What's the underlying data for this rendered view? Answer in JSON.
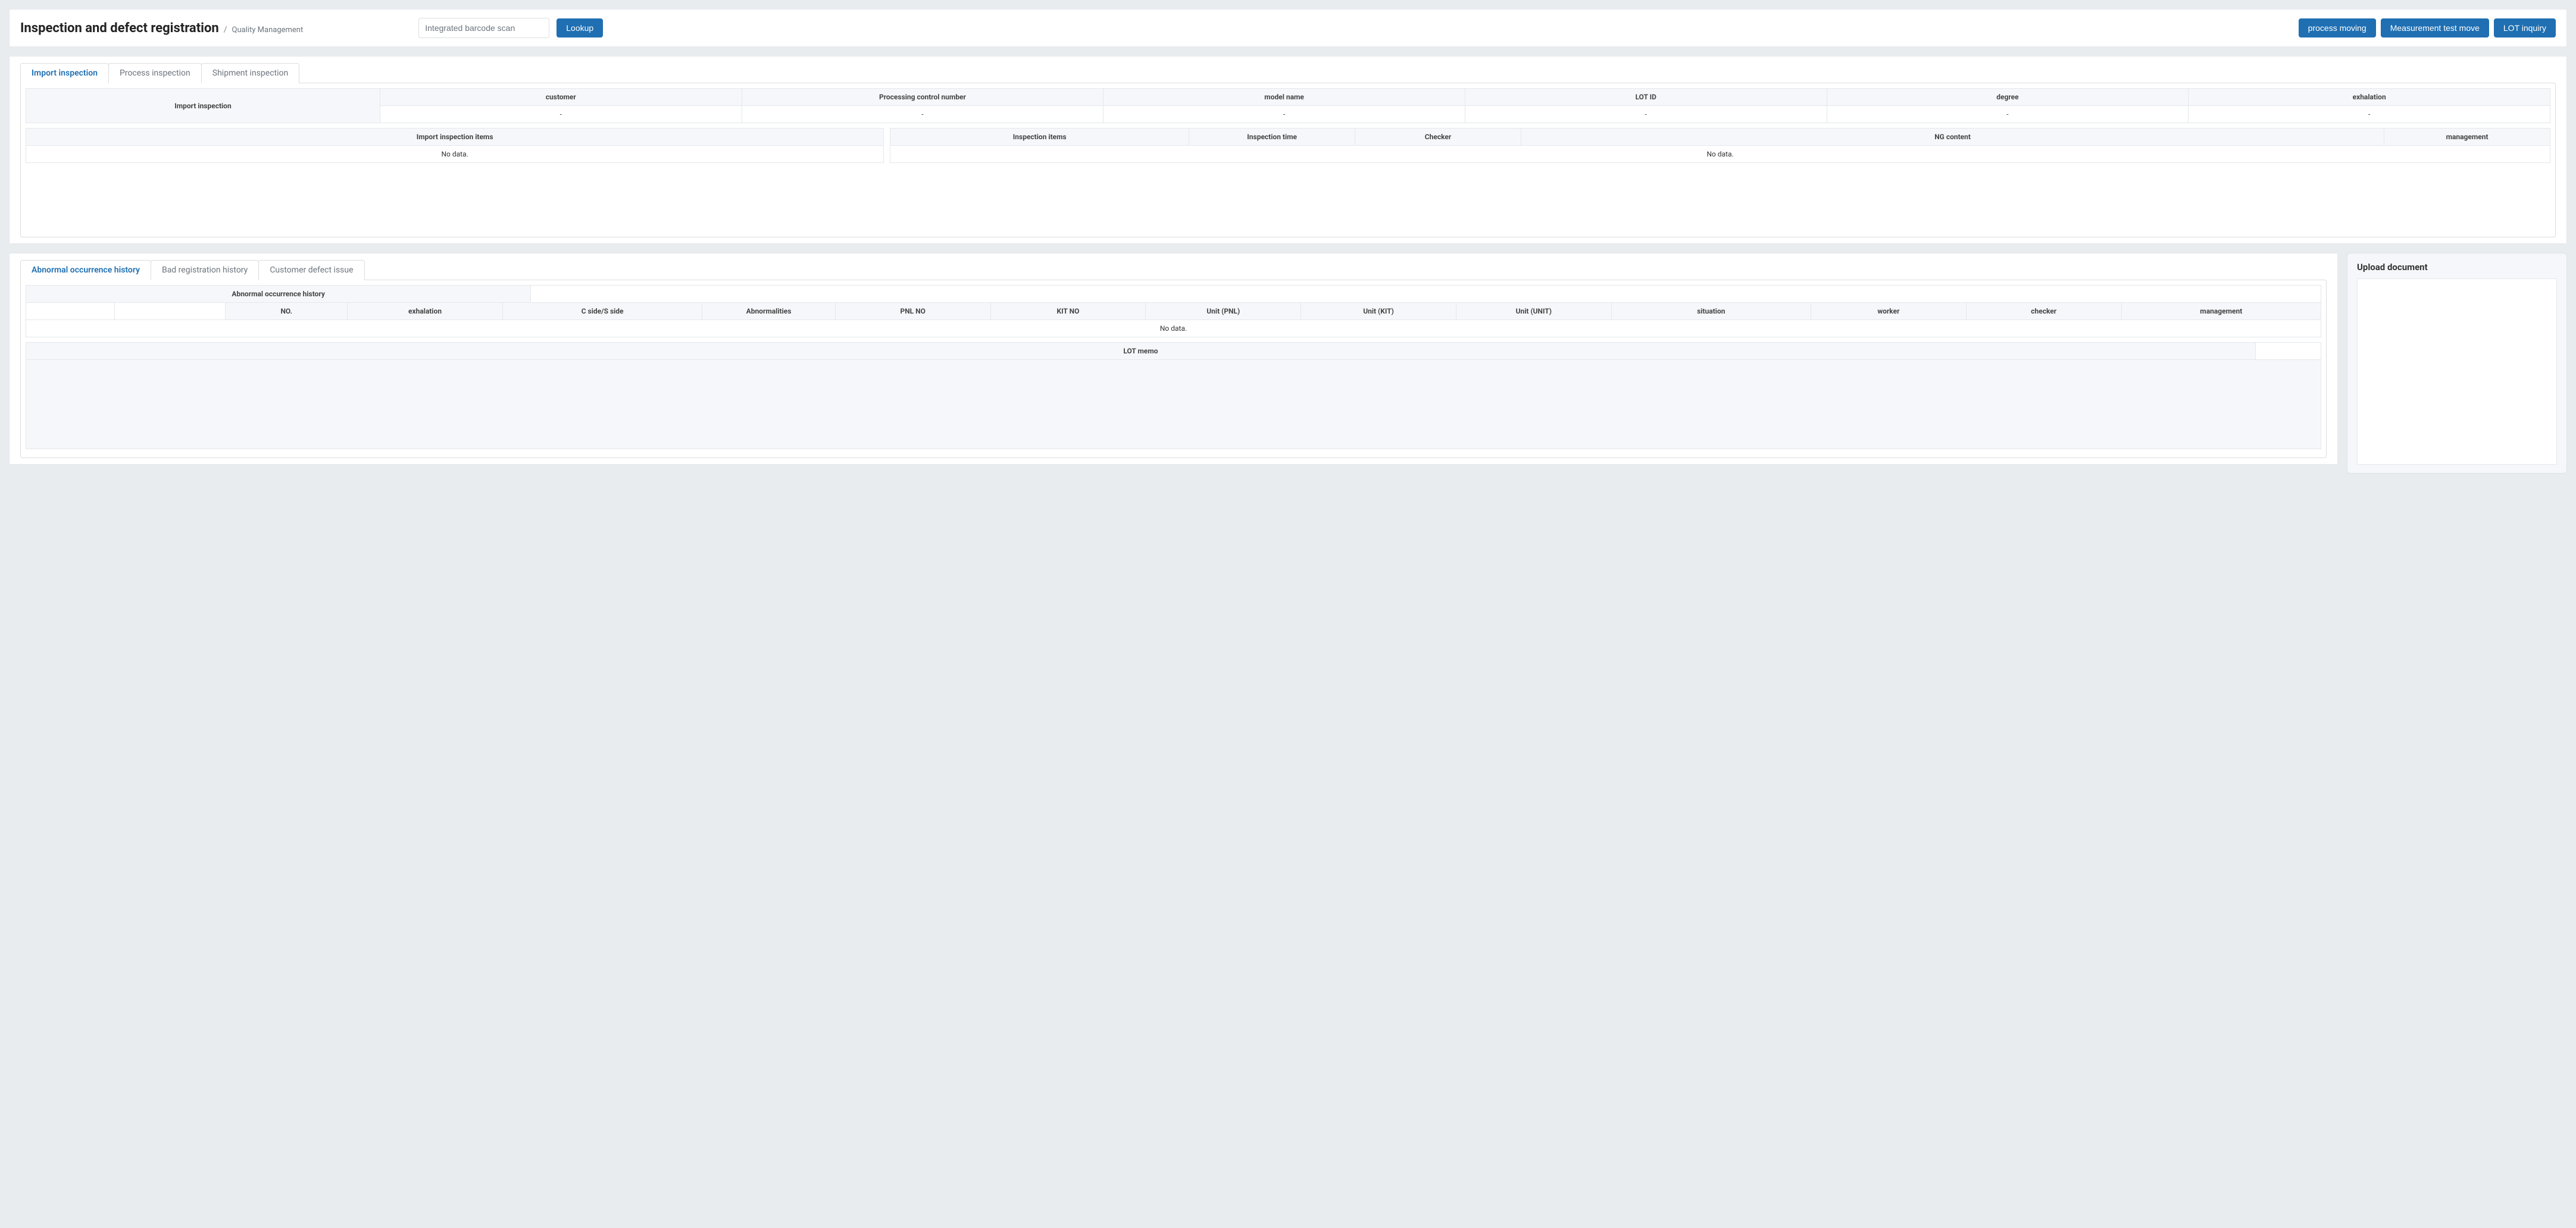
{
  "header": {
    "title": "Inspection and defect registration",
    "breadcrumb_sep": "/",
    "breadcrumb_sub": "Quality Management",
    "barcode_placeholder": "Integrated barcode scan",
    "lookup_label": "Lookup",
    "buttons": {
      "process_moving": "process moving",
      "measurement_test_move": "Measurement test move",
      "lot_inquiry": "LOT inquiry"
    }
  },
  "inspect_tabs": {
    "items": [
      {
        "label": "Import inspection"
      },
      {
        "label": "Process inspection"
      },
      {
        "label": "Shipment inspection"
      }
    ],
    "info_row_header": "Import inspection",
    "info_cols": [
      "customer",
      "Processing control number",
      "model name",
      "LOT ID",
      "degree",
      "exhalation"
    ],
    "info_vals": [
      "-",
      "-",
      "-",
      "-",
      "-",
      "-"
    ],
    "left_table": {
      "header": "Import inspection items",
      "no_data": "No data."
    },
    "right_table": {
      "headers": [
        "Inspection items",
        "Inspection time",
        "Checker",
        "NG content",
        "management"
      ],
      "no_data": "No data."
    }
  },
  "history_tabs": {
    "items": [
      {
        "label": "Abnormal occurrence history"
      },
      {
        "label": "Bad registration history"
      },
      {
        "label": "Customer defect issue"
      }
    ],
    "row_header": "Abnormal occurrence history",
    "cols": [
      "NO.",
      "exhalation",
      "C side/S side",
      "Abnormalities",
      "PNL NO",
      "KIT NO",
      "Unit (PNL)",
      "Unit (KIT)",
      "Unit (UNIT)",
      "situation",
      "worker",
      "checker",
      "management"
    ],
    "no_data": "No data.",
    "lot_memo_header": "LOT memo"
  },
  "upload": {
    "title": "Upload document"
  }
}
